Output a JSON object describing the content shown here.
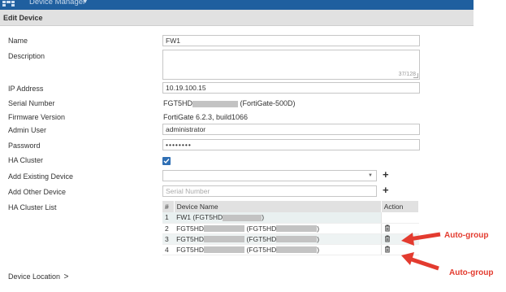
{
  "app": {
    "title": "Device Manager"
  },
  "section": {
    "title": "Edit Device"
  },
  "form": {
    "name": {
      "label": "Name",
      "value": "FW1"
    },
    "description": {
      "label": "Description",
      "value": "",
      "counter": "37/128"
    },
    "ip_address": {
      "label": "IP Address",
      "value": "10.19.100.15"
    },
    "serial_number": {
      "label": "Serial Number",
      "value_prefix": "FGT5HD",
      "value_suffix": "(FortiGate-500D)"
    },
    "firmware_version": {
      "label": "Firmware Version",
      "value": "FortiGate 6.2.3, build1066"
    },
    "admin_user": {
      "label": "Admin User",
      "value": "administrator"
    },
    "password": {
      "label": "Password",
      "value": "••••••••"
    },
    "ha_cluster": {
      "label": "HA Cluster",
      "checked": true
    },
    "add_existing_device": {
      "label": "Add Existing Device",
      "value": ""
    },
    "add_other_device": {
      "label": "Add Other Device",
      "placeholder": "Serial Number"
    },
    "ha_cluster_list": {
      "label": "HA Cluster List"
    }
  },
  "ha_table": {
    "columns": [
      "#",
      "Device Name",
      "Action"
    ],
    "rows": [
      {
        "num": "1",
        "name_a": "FW1 (FGT5HD",
        "name_b": ")",
        "has_action": false
      },
      {
        "num": "2",
        "name_a": "FGT5HD",
        "name_b": "(FGT5HD",
        "name_c": ")",
        "has_action": true
      },
      {
        "num": "3",
        "name_a": "FGT5HD",
        "name_b": "(FGT5HD",
        "name_c": ")",
        "has_action": true
      },
      {
        "num": "4",
        "name_a": "FGT5HD",
        "name_b": "(FGT5HD",
        "name_c": ")",
        "has_action": true
      }
    ]
  },
  "footer": {
    "device_location": "Device Location"
  },
  "annotations": {
    "label_1": "Auto-group",
    "label_2": "Auto-group",
    "color": "#e33b2f"
  },
  "colors": {
    "topbar": "#1f5f9f",
    "header": "#e1e1e1",
    "checkbox": "#2f6fb4"
  }
}
